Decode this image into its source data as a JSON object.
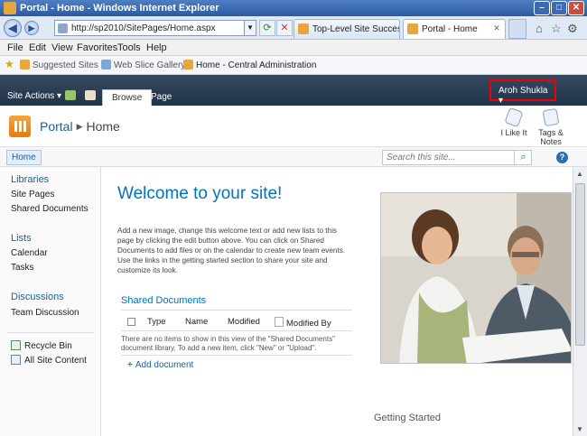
{
  "window": {
    "title": "Portal - Home - Windows Internet Explorer"
  },
  "address": {
    "url": "http://sp2010/SitePages/Home.aspx"
  },
  "tabs": [
    {
      "label": "Top-Level Site Successf..."
    },
    {
      "label": "Portal - Home"
    }
  ],
  "menu": [
    "File",
    "Edit",
    "View",
    "Favorites",
    "Tools",
    "Help"
  ],
  "favorites": [
    {
      "label": "Suggested Sites ▾"
    },
    {
      "label": "Web Slice Gallery ▾"
    },
    {
      "label": "Home - Central Administration"
    }
  ],
  "ribbon": {
    "site_actions": "Site Actions ▾",
    "tabs": [
      "Browse",
      "Page"
    ],
    "user": "Aroh Shukla ▾"
  },
  "title_area": {
    "site": "Portal",
    "page": "Home",
    "like": "I Like It",
    "tags": "Tags &",
    "notes": "Notes"
  },
  "topnav": {
    "home": "Home",
    "search_placeholder": "Search this site...",
    "help": "?"
  },
  "leftnav": {
    "libraries": "Libraries",
    "site_pages": "Site Pages",
    "shared_documents": "Shared Documents",
    "lists": "Lists",
    "calendar": "Calendar",
    "tasks": "Tasks",
    "discussions": "Discussions",
    "team_discussion": "Team Discussion",
    "recycle_bin": "Recycle Bin",
    "all_site_content": "All Site Content"
  },
  "main": {
    "heading": "Welcome to your site!",
    "body": "Add a new image, change this welcome text or add new lists to this page by clicking the edit button above. You can click on Shared Documents to add files or on the calendar to create new team events. Use the links in the getting started section to share your site and customize its look.",
    "shared_docs_title": "Shared Documents",
    "columns": [
      "Type",
      "Name",
      "Modified",
      "Modified By"
    ],
    "empty_message": "There are no items to show in this view of the \"Shared Documents\" document library. To add a new item, click \"New\" or \"Upload\".",
    "add_document": "Add document",
    "getting_started": "Getting Started"
  }
}
